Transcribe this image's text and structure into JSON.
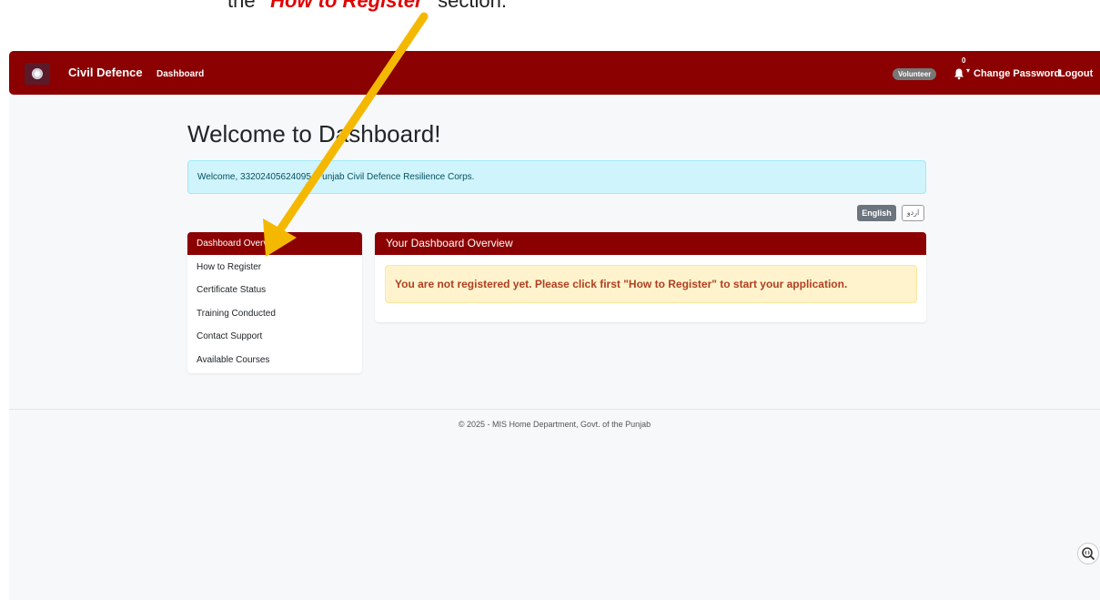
{
  "instruction": {
    "prefix": "the ",
    "highlight": "\"How to Register\"",
    "suffix": " section."
  },
  "navbar": {
    "brand": "Civil Defence",
    "nav_link": "Dashboard",
    "role_badge": "Volunteer",
    "notification_count": "0",
    "change_password": "Change Password",
    "logout": "Logout"
  },
  "page": {
    "title": "Welcome to Dashboard!",
    "welcome_message": "Welcome, 33202405624095, Punjab Civil Defence Resilience Corps."
  },
  "language": {
    "english": "English",
    "urdu": "اردو"
  },
  "sidebar": {
    "items": [
      {
        "label": "Dashboard Overview"
      },
      {
        "label": "How to Register"
      },
      {
        "label": "Certificate Status"
      },
      {
        "label": "Training Conducted"
      },
      {
        "label": "Contact Support"
      },
      {
        "label": "Available Courses"
      }
    ]
  },
  "panel": {
    "title": "Your Dashboard Overview",
    "alert": "You are not registered yet. Please click first \"How to Register\" to start your application."
  },
  "footer": {
    "text": "© 2025 - MIS Home Department, Govt. of the Punjab"
  },
  "colors": {
    "brand": "#8b0000",
    "arrow": "#f5b800",
    "highlight": "#e00000"
  }
}
